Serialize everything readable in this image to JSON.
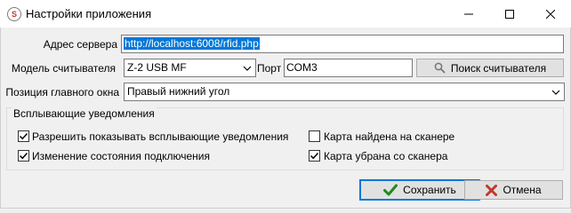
{
  "window": {
    "title": "Настройки приложения",
    "app_icon_glyph": "S"
  },
  "form": {
    "server_address": {
      "label": "Адрес сервера",
      "value": "http://localhost:6008/rfid.php"
    },
    "reader_model": {
      "label": "Модель считывателя",
      "value": "Z-2 USB MF"
    },
    "port": {
      "label": "Порт",
      "value": "COM3"
    },
    "search_reader_label": "Поиск считывателя",
    "main_window_position": {
      "label": "Позиция главного окна",
      "value": "Правый нижний угол"
    }
  },
  "notifications": {
    "title": "Всплывающие уведомления",
    "options": [
      {
        "label": "Разрешить показывать всплывающие уведомления",
        "checked": true
      },
      {
        "label": "Изменение состояния подключения",
        "checked": true
      },
      {
        "label": "Карта найдена на сканере",
        "checked": false
      },
      {
        "label": "Карта убрана со сканера",
        "checked": true
      }
    ]
  },
  "buttons": {
    "save_label": "Сохранить",
    "cancel_label": "Отмена"
  },
  "colors": {
    "selection": "#0078d7",
    "save_icon": "#1e8a1e",
    "cancel_icon": "#c0392b"
  }
}
